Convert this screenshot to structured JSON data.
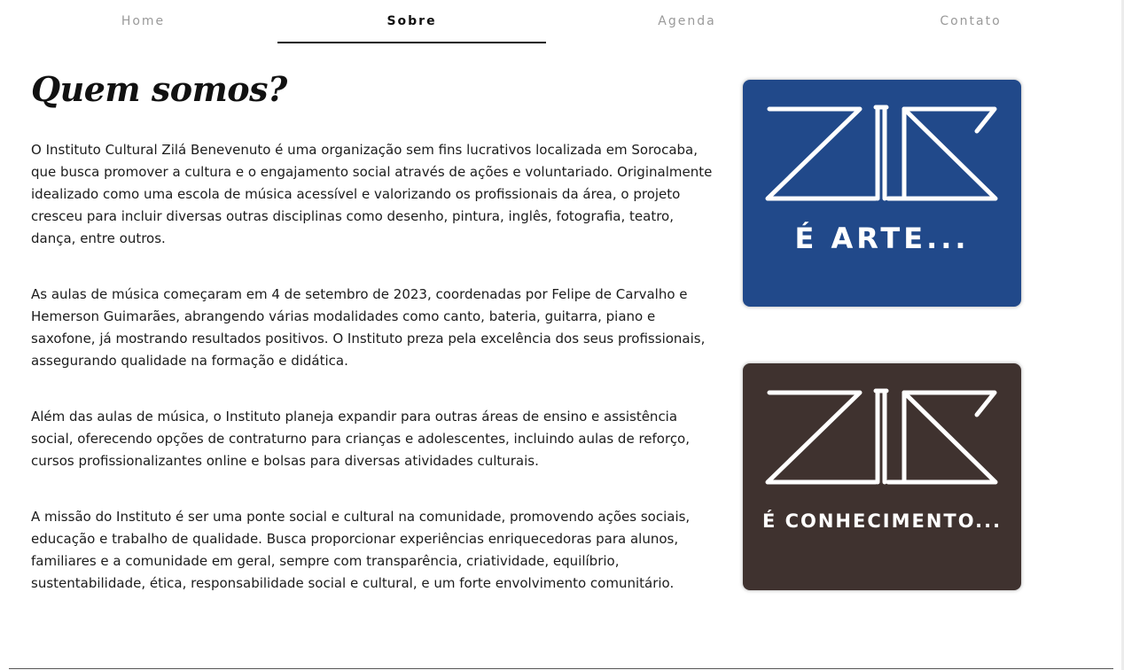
{
  "nav": {
    "items": [
      {
        "label": "Home"
      },
      {
        "label": "Sobre"
      },
      {
        "label": "Agenda"
      },
      {
        "label": "Contato"
      }
    ],
    "active": "Sobre"
  },
  "about": {
    "title": "Quem somos?",
    "paragraphs": [
      "O Instituto Cultural Zilá Benevenuto é uma organização sem fins lucrativos localizada em Sorocaba, que busca promover a cultura e o engajamento social através de ações e voluntariado. Originalmente idealizado como uma escola de música acessível e valorizando os profissionais da área, o projeto cresceu para incluir diversas outras disciplinas como desenho, pintura, inglês, fotografia, teatro, dança, entre outros.",
      "As aulas de música começaram em 4 de setembro de 2023, coordenadas por Felipe de Carvalho e Hemerson Guimarães, abrangendo várias modalidades como canto, bateria, guitarra, piano e saxofone, já mostrando resultados positivos. O Instituto preza pela excelência dos seus profissionais, assegurando qualidade na formação e didática.",
      "Além das aulas de música, o Instituto planeja expandir para outras áreas de ensino e assistência social, oferecendo opções de contraturno para crianças e adolescentes, incluindo aulas de reforço, cursos profissionalizantes online e bolsas para diversas atividades culturais.",
      "A missão do Instituto é ser uma ponte social e cultural na comunidade, promovendo ações sociais, educação e trabalho de qualidade. Busca proporcionar experiências enriquecedoras para alunos, familiares e a comunidade em geral, sempre com transparência, criatividade, equilíbrio, sustentabilidade, ética, responsabilidade social e cultural, e um forte envolvimento comunitário."
    ]
  },
  "logos": [
    {
      "caption": "É ARTE...",
      "background": "#21498a"
    },
    {
      "caption": "É CONHECIMENTO...",
      "background": "#3f322f"
    }
  ],
  "colors": {
    "nav_inactive": "#9a9a9a",
    "nav_active": "#111111",
    "text": "#1c1c1c"
  }
}
